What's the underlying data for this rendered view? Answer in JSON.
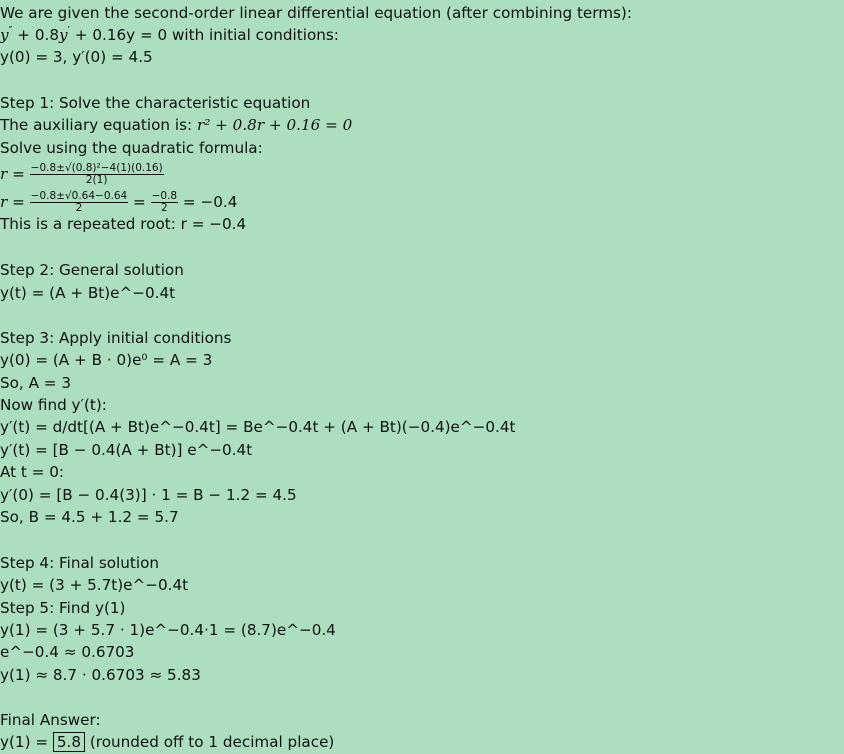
{
  "lines": {
    "intro": "We are given the second-order linear differential equation (after combining terms):",
    "eq_tail": " + 0.16y = 0 with initial conditions:",
    "ic": "y(0) = 3, y′(0) = 4.5",
    "step1_heading": "Step 1: Solve the characteristic equation",
    "aux_label": "The auxiliary equation is: ",
    "aux_eq": "r² + 0.8r + 0.16 = 0",
    "quad_label": "Solve using the quadratic formula:",
    "quad_num": "−0.8±√(0.8)²−4(1)(0.16)",
    "quad_den": "2(1)",
    "simp_num": "−0.8±√0.64−0.64",
    "simp_den": "2",
    "simp2_num": "−0.8",
    "simp2_den": "2",
    "simp_result": " = −0.4",
    "repeated": "This is a repeated root: r = −0.4",
    "step2_heading": "Step 2: General solution",
    "general": "y(t) = (A + Bt)e^−0.4t",
    "step3_heading": "Step 3: Apply initial conditions",
    "y0_eval": "y(0) = (A + B · 0)e⁰ = A = 3",
    "so_a": "So, A = 3",
    "now_find": "Now find y′(t):",
    "deriv1": "y′(t) = d/dt[(A + Bt)e^−0.4t] = Be^−0.4t + (A + Bt)(−0.4)e^−0.4t",
    "deriv2": "y′(t) = [B − 0.4(A + Bt)] e^−0.4t",
    "at_t0": "At t = 0:",
    "yp0_eval": "y′(0) = [B − 0.4(3)] · 1 = B − 1.2 = 4.5",
    "so_b": "So, B = 4.5 + 1.2 = 5.7",
    "step4_heading": "Step 4: Final solution",
    "final_solution": "y(t) = (3 + 5.7t)e^−0.4t",
    "step5_heading": "Step 5: Find y(1)",
    "y1_eval": "y(1) = (3 + 5.7 · 1)e^−0.4·1 = (8.7)e^−0.4",
    "exp_value": "e^−0.4 ≈ 0.6703",
    "y1_approx": "y(1) ≈ 8.7 · 0.6703 ≈ 5.83",
    "final_label": "Final Answer:",
    "final_prefix": "y(1) = ",
    "final_value": "5.8",
    "final_suffix": " (rounded off to 1 decimal place)"
  }
}
